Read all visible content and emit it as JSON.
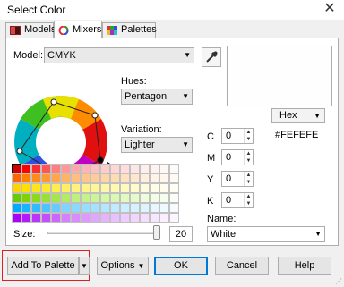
{
  "window": {
    "title": "Select Color",
    "close_glyph": "✕"
  },
  "tabs": [
    {
      "label": "Models",
      "icon": "models-icon"
    },
    {
      "label": "Mixers",
      "icon": "mixers-icon"
    },
    {
      "label": "Palettes",
      "icon": "palettes-icon"
    }
  ],
  "active_tab": "Mixers",
  "model": {
    "label": "Model:",
    "value": "CMYK"
  },
  "hues": {
    "label": "Hues:",
    "value": "Pentagon"
  },
  "variation": {
    "label": "Variation:",
    "value": "Lighter"
  },
  "cmyk": [
    {
      "label": "C",
      "value": "0"
    },
    {
      "label": "M",
      "value": "0"
    },
    {
      "label": "Y",
      "value": "0"
    },
    {
      "label": "K",
      "value": "0"
    }
  ],
  "hex": {
    "format": "Hex",
    "value": "#FEFEFE"
  },
  "name": {
    "label": "Name:",
    "value": "White"
  },
  "size": {
    "label": "Size:",
    "value": "20"
  },
  "swatch_colors": [
    [
      "#d40000",
      "#ff0000",
      "#ff2a2a",
      "#ff5555",
      "#ff7f7f",
      "#ff9999",
      "#ffaaaa",
      "#ffb3b3",
      "#ffbfbf",
      "#ffcccc",
      "#ffd5d5",
      "#ffdddd",
      "#ffe6e6",
      "#ffeeee",
      "#fff2f2",
      "#fff6f6",
      "#fffafa"
    ],
    [
      "#ff6600",
      "#ff7f00",
      "#ff8c1a",
      "#ff9933",
      "#ffa64d",
      "#ffb366",
      "#ffbf80",
      "#ffc68c",
      "#ffcc99",
      "#ffd5a8",
      "#ffdbb3",
      "#ffe0bf",
      "#ffe6cc",
      "#ffeedd",
      "#fff2e6",
      "#fff6ee",
      "#fffaf5"
    ],
    [
      "#ffd400",
      "#ffe000",
      "#ffe51a",
      "#ffe933",
      "#ffec4d",
      "#ffef66",
      "#fff280",
      "#fff48c",
      "#fff599",
      "#fff7a8",
      "#fff8b3",
      "#fffabf",
      "#fffbcc",
      "#fffcdd",
      "#fffde6",
      "#fffeee",
      "#fffef5"
    ],
    [
      "#66cc00",
      "#7fd400",
      "#8cdb1a",
      "#99e033",
      "#a6e64d",
      "#b3eb66",
      "#bff080",
      "#c6f28c",
      "#ccf599",
      "#d5f7a8",
      "#dbf8b3",
      "#e0fabf",
      "#e6fbcc",
      "#eefcdd",
      "#f2fde6",
      "#f6feee",
      "#fafff5"
    ],
    [
      "#00aaff",
      "#1ab3ff",
      "#33bbff",
      "#4dc4ff",
      "#66ccff",
      "#80d4ff",
      "#8cd9ff",
      "#99ddff",
      "#a6e1ff",
      "#b3e6ff",
      "#bfeaff",
      "#ccefff",
      "#d5f2ff",
      "#ddf4ff",
      "#e6f7ff",
      "#eefaff",
      "#f5fcff"
    ],
    [
      "#aa00ff",
      "#b31aff",
      "#bb33ff",
      "#c44dff",
      "#cc66ff",
      "#d480ff",
      "#d98cff",
      "#dd99ff",
      "#e1a6ff",
      "#e6b3ff",
      "#eabfff",
      "#efccff",
      "#f2d5ff",
      "#f4ddff",
      "#f7e6ff",
      "#faeeff",
      "#fcf5ff"
    ]
  ],
  "buttons": {
    "add_to_palette": "Add To Palette",
    "options": "Options",
    "ok": "OK",
    "cancel": "Cancel",
    "help": "Help"
  },
  "colors": {
    "highlight_red": "#e02020",
    "focus_blue": "#0078d7"
  }
}
